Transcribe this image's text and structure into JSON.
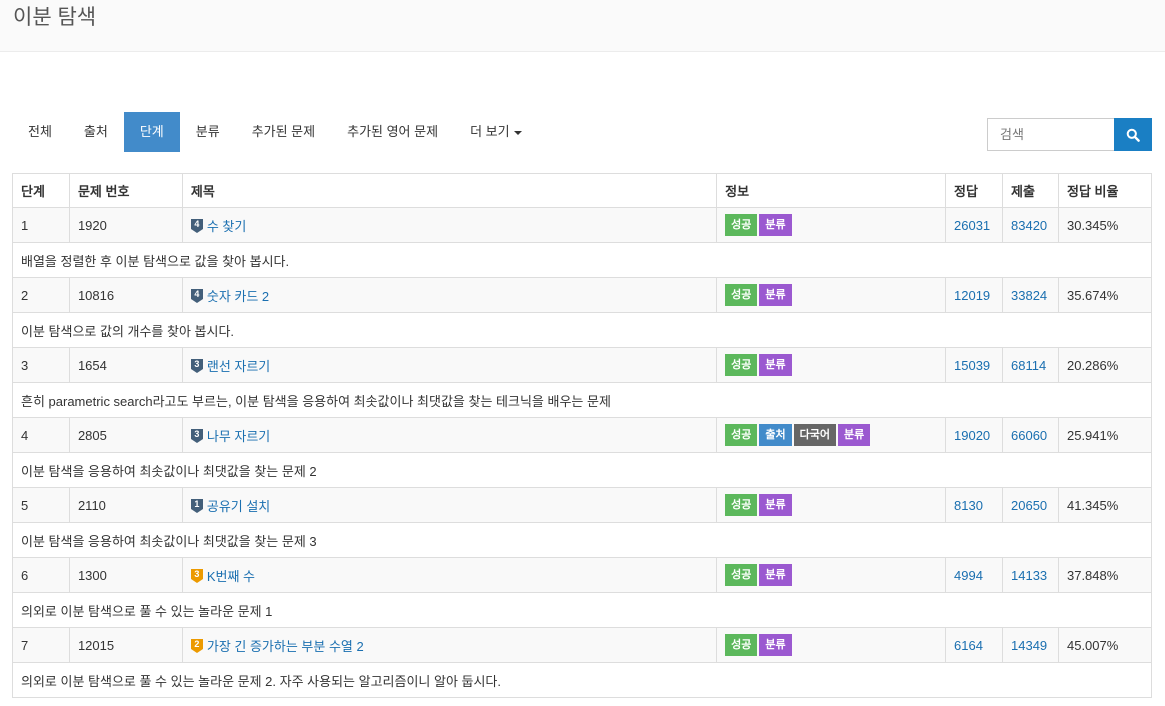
{
  "header": {
    "title": "이분 탐색"
  },
  "tabs": [
    {
      "label": "전체"
    },
    {
      "label": "출처"
    },
    {
      "label": "단계"
    },
    {
      "label": "분류"
    },
    {
      "label": "추가된 문제"
    },
    {
      "label": "추가된 영어 문제"
    },
    {
      "label": "더 보기"
    }
  ],
  "search": {
    "placeholder": "검색"
  },
  "table": {
    "headers": [
      "단계",
      "문제 번호",
      "제목",
      "정보",
      "정답",
      "제출",
      "정답 비율"
    ],
    "rows": [
      {
        "step": "1",
        "id": "1920",
        "tier": "4",
        "tier_color": "#435f7a",
        "title": "수 찾기",
        "badges": [
          "성공",
          "분류"
        ],
        "accepted": "26031",
        "submissions": "83420",
        "ratio": "30.345%",
        "desc": "배열을 정렬한 후 이분 탐색으로 값을 찾아 봅시다."
      },
      {
        "step": "2",
        "id": "10816",
        "tier": "4",
        "tier_color": "#435f7a",
        "title": "숫자 카드 2",
        "badges": [
          "성공",
          "분류"
        ],
        "accepted": "12019",
        "submissions": "33824",
        "ratio": "35.674%",
        "desc": "이분 탐색으로 값의 개수를 찾아 봅시다."
      },
      {
        "step": "3",
        "id": "1654",
        "tier": "3",
        "tier_color": "#435f7a",
        "title": "랜선 자르기",
        "badges": [
          "성공",
          "분류"
        ],
        "accepted": "15039",
        "submissions": "68114",
        "ratio": "20.286%",
        "desc": "흔히 parametric search라고도 부르는, 이분 탐색을 응용하여 최솟값이나 최댓값을 찾는 테크닉을 배우는 문제"
      },
      {
        "step": "4",
        "id": "2805",
        "tier": "3",
        "tier_color": "#435f7a",
        "title": "나무 자르기",
        "badges": [
          "성공",
          "출처",
          "다국어",
          "분류"
        ],
        "accepted": "19020",
        "submissions": "66060",
        "ratio": "25.941%",
        "desc": "이분 탐색을 응용하여 최솟값이나 최댓값을 찾는 문제 2"
      },
      {
        "step": "5",
        "id": "2110",
        "tier": "1",
        "tier_color": "#435f7a",
        "title": "공유기 설치",
        "badges": [
          "성공",
          "분류"
        ],
        "accepted": "8130",
        "submissions": "20650",
        "ratio": "41.345%",
        "desc": "이분 탐색을 응용하여 최솟값이나 최댓값을 찾는 문제 3"
      },
      {
        "step": "6",
        "id": "1300",
        "tier": "3",
        "tier_color": "#ec9a00",
        "title": "K번째 수",
        "badges": [
          "성공",
          "분류"
        ],
        "accepted": "4994",
        "submissions": "14133",
        "ratio": "37.848%",
        "desc": "의외로 이분 탐색으로 풀 수 있는 놀라운 문제 1"
      },
      {
        "step": "7",
        "id": "12015",
        "tier": "2",
        "tier_color": "#ec9a00",
        "title": "가장 긴 증가하는 부분 수열 2",
        "badges": [
          "성공",
          "분류"
        ],
        "accepted": "6164",
        "submissions": "14349",
        "ratio": "45.007%",
        "desc": "의외로 이분 탐색으로 풀 수 있는 놀라운 문제 2. 자주 사용되는 알고리즘이니 알아 둡시다."
      }
    ]
  },
  "colors": {
    "accent": "#428bca",
    "link": "#1a6fb0",
    "success": "#5cb85c",
    "category": "#9b59d0",
    "source": "#428bca",
    "language": "#666666"
  }
}
